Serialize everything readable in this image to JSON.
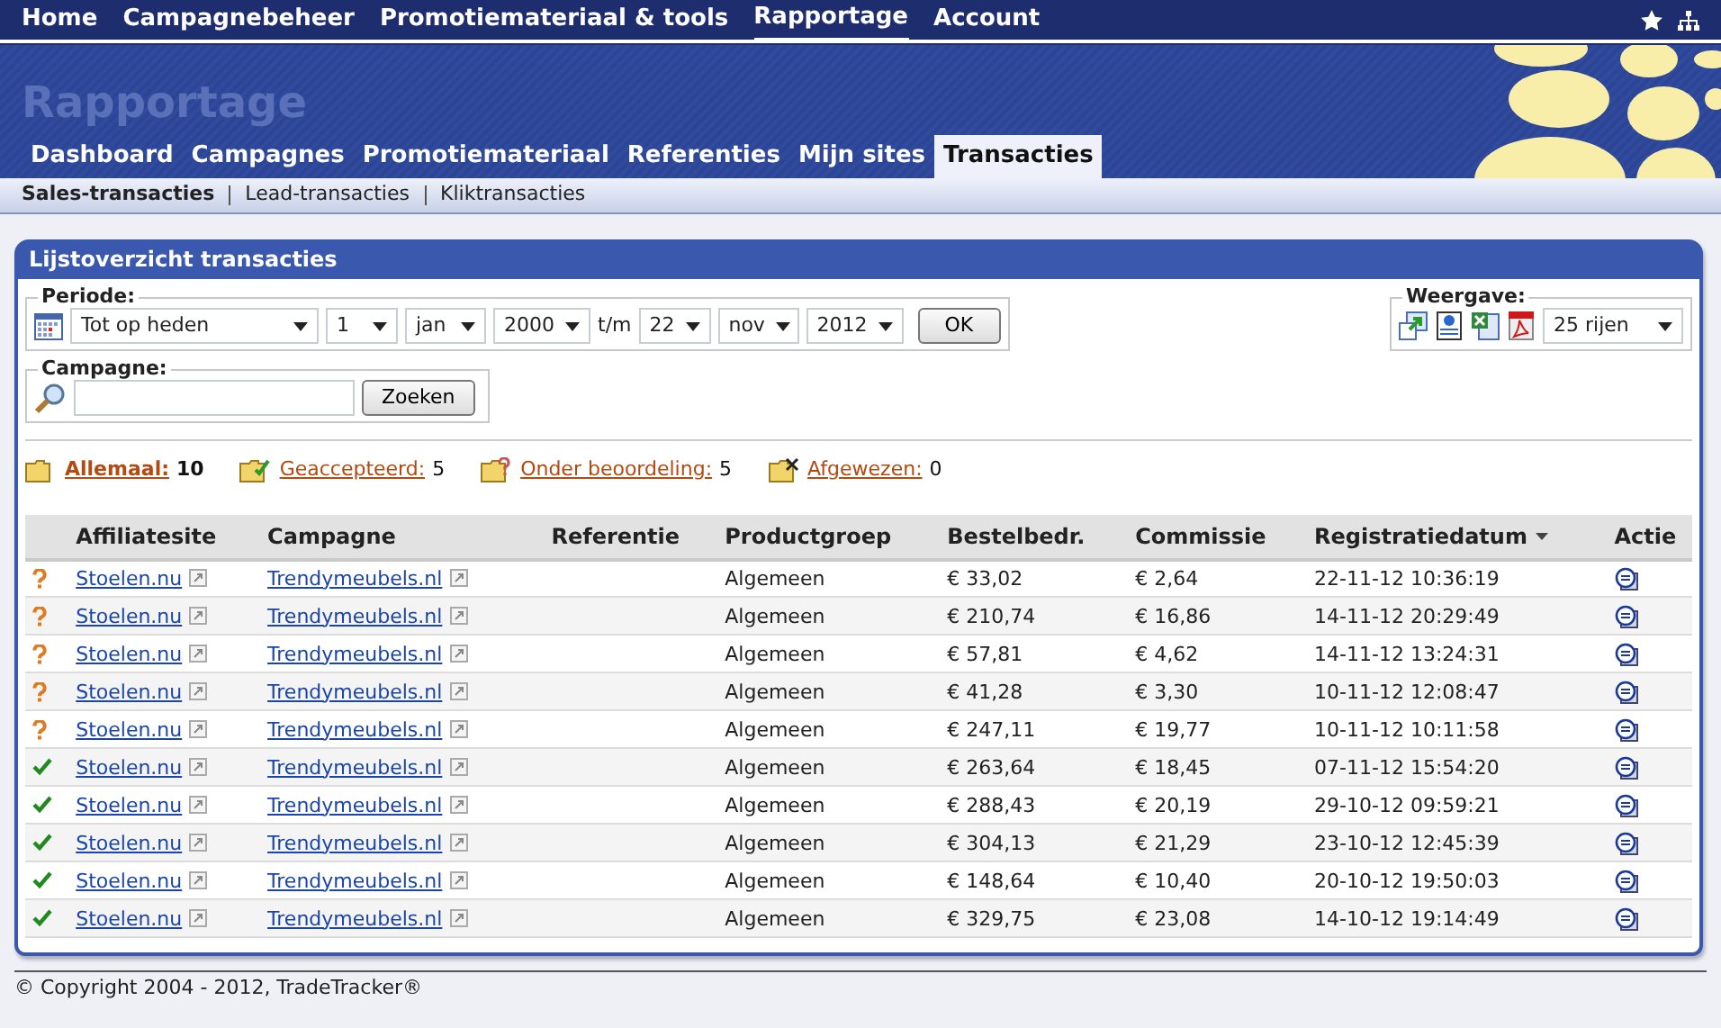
{
  "top_nav": [
    {
      "label": "Home",
      "selected": false
    },
    {
      "label": "Campagnebeheer",
      "selected": false
    },
    {
      "label": "Promotiemateriaal & tools",
      "selected": false
    },
    {
      "label": "Rapportage",
      "selected": true
    },
    {
      "label": "Account",
      "selected": false
    }
  ],
  "banner_title": "Rapportage",
  "tabs": [
    {
      "label": "Dashboard",
      "selected": false
    },
    {
      "label": "Campagnes",
      "selected": false
    },
    {
      "label": "Promotiemateriaal",
      "selected": false
    },
    {
      "label": "Referenties",
      "selected": false
    },
    {
      "label": "Mijn sites",
      "selected": false
    },
    {
      "label": "Transacties",
      "selected": true
    }
  ],
  "subtabs": [
    {
      "label": "Sales-transacties",
      "selected": true
    },
    {
      "label": "Lead-transacties",
      "selected": false
    },
    {
      "label": "Kliktransacties",
      "selected": false
    }
  ],
  "panel": {
    "title": "Lijstoverzicht transacties",
    "periode": {
      "legend": "Periode:",
      "preset": "Tot op heden",
      "from": [
        "1",
        "jan",
        "2000"
      ],
      "separator": "t/m",
      "to": [
        "22",
        "nov",
        "2012"
      ],
      "button": "OK"
    },
    "campagne": {
      "legend": "Campagne:",
      "button": "Zoeken"
    },
    "weergave": {
      "legend": "Weergave:",
      "rows": "25 rijen"
    },
    "filters": [
      {
        "kind": "all",
        "label": "Allemaal:",
        "count": "10",
        "selected": true
      },
      {
        "kind": "accepted",
        "label": "Geaccepteerd:",
        "count": "5",
        "selected": false
      },
      {
        "kind": "pending",
        "label": "Onder beoordeling:",
        "count": "5",
        "selected": false
      },
      {
        "kind": "rejected",
        "label": "Afgewezen:",
        "count": "0",
        "selected": false
      }
    ],
    "table": {
      "columns": [
        "Affiliatesite",
        "Campagne",
        "Referentie",
        "Productgroep",
        "Bestelbedr.",
        "Commissie",
        "Registratiedatum",
        "Actie"
      ],
      "rows": [
        {
          "kind": "pending",
          "site": "Stoelen.nu",
          "campaign": "Trendymeubels.nl",
          "group": "Algemeen",
          "amount": "€ 33,02",
          "commission": "€ 2,64",
          "date": "22-11-12 10:36:19"
        },
        {
          "kind": "pending",
          "site": "Stoelen.nu",
          "campaign": "Trendymeubels.nl",
          "group": "Algemeen",
          "amount": "€ 210,74",
          "commission": "€ 16,86",
          "date": "14-11-12 20:29:49"
        },
        {
          "kind": "pending",
          "site": "Stoelen.nu",
          "campaign": "Trendymeubels.nl",
          "group": "Algemeen",
          "amount": "€ 57,81",
          "commission": "€ 4,62",
          "date": "14-11-12 13:24:31"
        },
        {
          "kind": "pending",
          "site": "Stoelen.nu",
          "campaign": "Trendymeubels.nl",
          "group": "Algemeen",
          "amount": "€ 41,28",
          "commission": "€ 3,30",
          "date": "10-11-12 12:08:47"
        },
        {
          "kind": "pending",
          "site": "Stoelen.nu",
          "campaign": "Trendymeubels.nl",
          "group": "Algemeen",
          "amount": "€ 247,11",
          "commission": "€ 19,77",
          "date": "10-11-12 10:11:58"
        },
        {
          "kind": "accepted",
          "site": "Stoelen.nu",
          "campaign": "Trendymeubels.nl",
          "group": "Algemeen",
          "amount": "€ 263,64",
          "commission": "€ 18,45",
          "date": "07-11-12 15:54:20"
        },
        {
          "kind": "accepted",
          "site": "Stoelen.nu",
          "campaign": "Trendymeubels.nl",
          "group": "Algemeen",
          "amount": "€ 288,43",
          "commission": "€ 20,19",
          "date": "29-10-12 09:59:21"
        },
        {
          "kind": "accepted",
          "site": "Stoelen.nu",
          "campaign": "Trendymeubels.nl",
          "group": "Algemeen",
          "amount": "€ 304,13",
          "commission": "€ 21,29",
          "date": "23-10-12 12:45:39"
        },
        {
          "kind": "accepted",
          "site": "Stoelen.nu",
          "campaign": "Trendymeubels.nl",
          "group": "Algemeen",
          "amount": "€ 148,64",
          "commission": "€ 10,40",
          "date": "20-10-12 19:50:03"
        },
        {
          "kind": "accepted",
          "site": "Stoelen.nu",
          "campaign": "Trendymeubels.nl",
          "group": "Algemeen",
          "amount": "€ 329,75",
          "commission": "€ 23,08",
          "date": "14-10-12 19:14:49"
        }
      ]
    }
  },
  "footer": "© Copyright 2004 - 2012, TradeTracker®"
}
